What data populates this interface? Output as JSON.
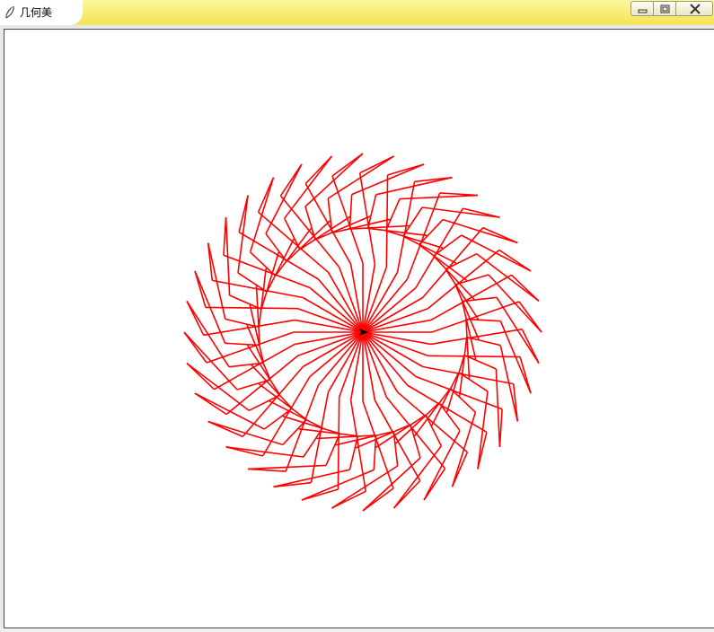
{
  "window": {
    "title": "几何美",
    "icon": "feather-icon",
    "controls": [
      "minimize-icon",
      "maximize-icon",
      "close-icon"
    ],
    "title_bar_color": "#f5e96a"
  },
  "canvas": {
    "background": "#ffffff",
    "stroke_color": "#ff0000",
    "turtle_color": "#000000",
    "pattern": {
      "repetitions": 36,
      "step_angle_deg": 10
    }
  }
}
